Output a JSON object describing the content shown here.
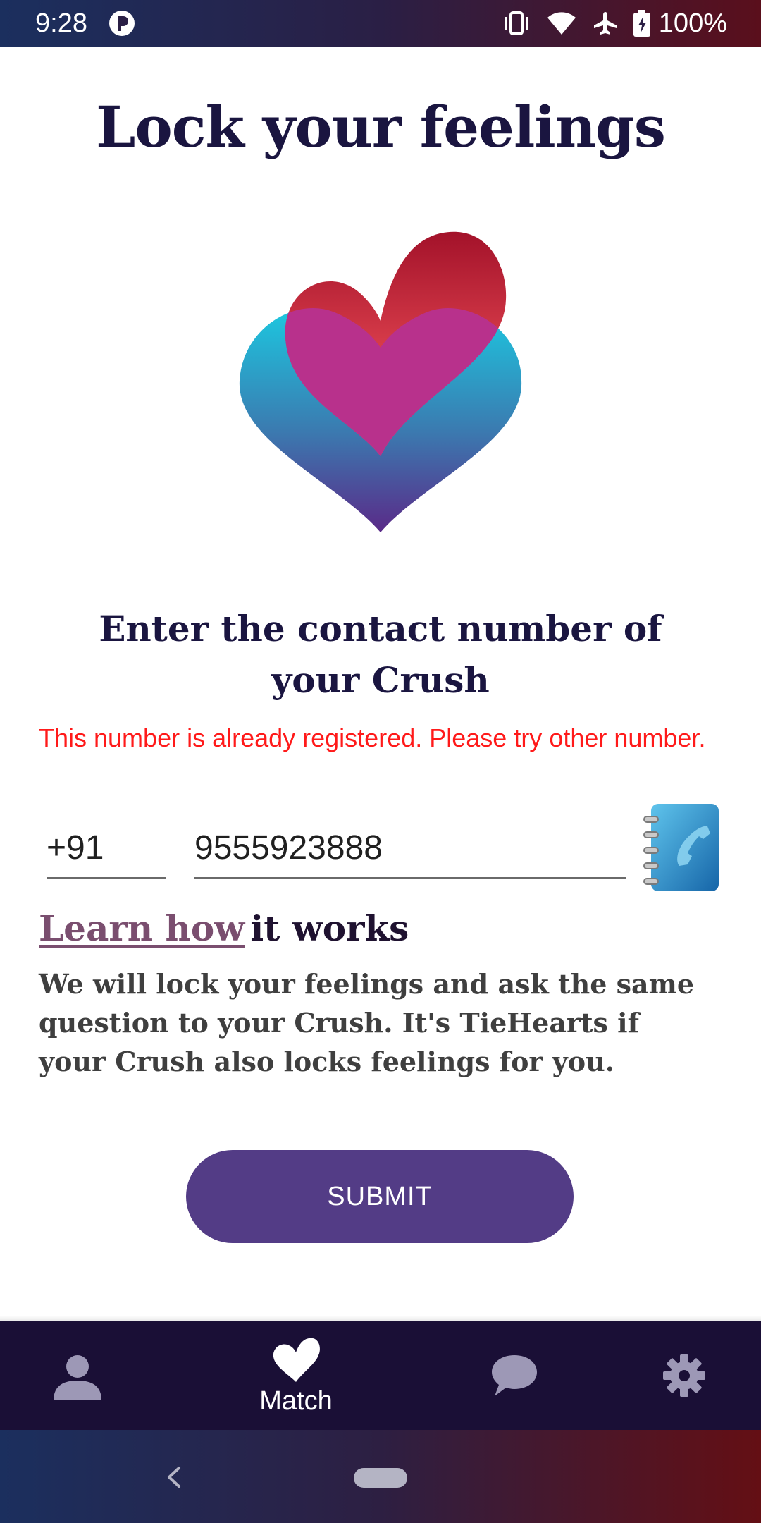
{
  "status_bar": {
    "time": "9:28",
    "battery_percent": "100%",
    "icons": [
      "notification-app-icon",
      "vibrate-icon",
      "wifi-icon",
      "airplane-mode-icon",
      "battery-charging-icon"
    ]
  },
  "page": {
    "title": "Lock your feelings",
    "logo_icon": "two-hearts-logo"
  },
  "form": {
    "prompt": "Enter the contact number of your Crush",
    "error": "This number is already registered. Please try other number.",
    "country_code": "+91",
    "phone_number": "9555923888",
    "contacts_icon": "contact-book-icon"
  },
  "info": {
    "link_label": "Learn how",
    "rest_label": "it works",
    "description": "We will lock your feelings and ask the same question to your Crush. It's TieHearts if your Crush also locks feelings for you."
  },
  "actions": {
    "submit_label": "SUBMIT"
  },
  "bottom_nav": {
    "items": [
      {
        "icon": "profile-icon",
        "label": ""
      },
      {
        "icon": "heart-icon",
        "label": "Match",
        "active": true
      },
      {
        "icon": "chat-icon",
        "label": ""
      },
      {
        "icon": "settings-icon",
        "label": ""
      }
    ]
  },
  "colors": {
    "title": "#1a1540",
    "error": "#ff1a1a",
    "link": "#7a4e6f",
    "submit_bg": "#533c86",
    "nav_bg": "#1a0f36",
    "inactive_icon": "#9d98b6"
  }
}
